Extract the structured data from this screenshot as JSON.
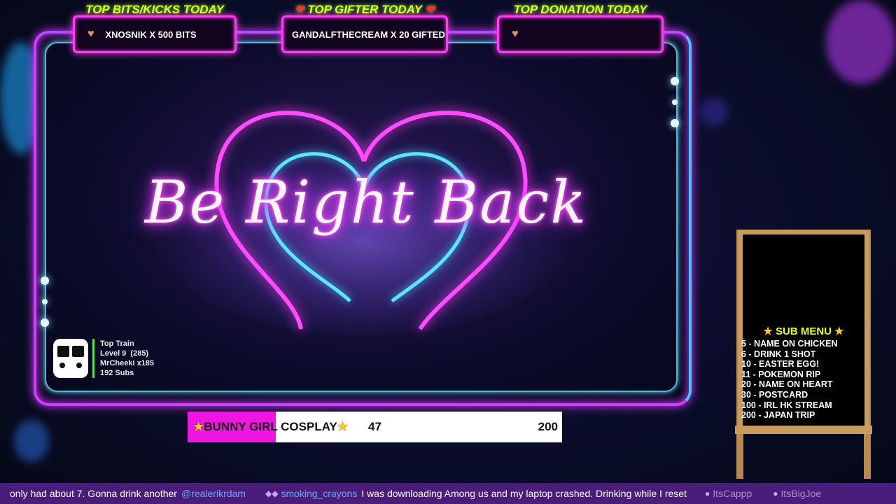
{
  "colors": {
    "neon_pink": "#ff3cf4",
    "neon_cyan": "#3fc8ff",
    "label_green": "#d7ff2e",
    "goal_magenta": "#ee16e0"
  },
  "top_boxes": [
    {
      "label": "TOP BITS/KICKS TODAY",
      "icon": "heart-icon",
      "value": "XNOSNIK X 500 BITS"
    },
    {
      "label": "TOP GIFTER TODAY",
      "icon": "red-heart-icon",
      "value": "GANDALFTHECREAM X 20 GIFTED"
    },
    {
      "label": "TOP DONATION TODAY",
      "icon": "heart-icon",
      "value": ""
    }
  ],
  "main_text": "Be Right Back",
  "top_train": {
    "title": "Top Train",
    "level": "Level 9  (285)",
    "top_contributor": "MrCheeki x185",
    "subs": "192 Subs"
  },
  "goal": {
    "title": "BUNNY GIRL COSPLAY",
    "current": "47",
    "target": "200",
    "progress_fraction": 0.235
  },
  "sub_menu": {
    "title": "SUB MENU",
    "items": [
      "5 - NAME ON CHICKEN",
      "6 - DRINK 1 SHOT",
      "10 - EASTER EGG!",
      "11 - POKEMON RIP",
      "20 - NAME ON HEART",
      "30 - POSTCARD",
      "100 - IRL HK STREAM",
      "200 - JAPAN TRIP"
    ]
  },
  "chat": {
    "msg1_text": "only had about 7. Gonna drink another",
    "msg1_mention": "@realerikrdam",
    "msg2_user": "smoking_crayons",
    "msg2_text": "I was downloading Among us and my laptop crashed. Drinking while I reset",
    "msg3_user": "ItsCappp",
    "msg4_user": "ItsBigJoe"
  }
}
